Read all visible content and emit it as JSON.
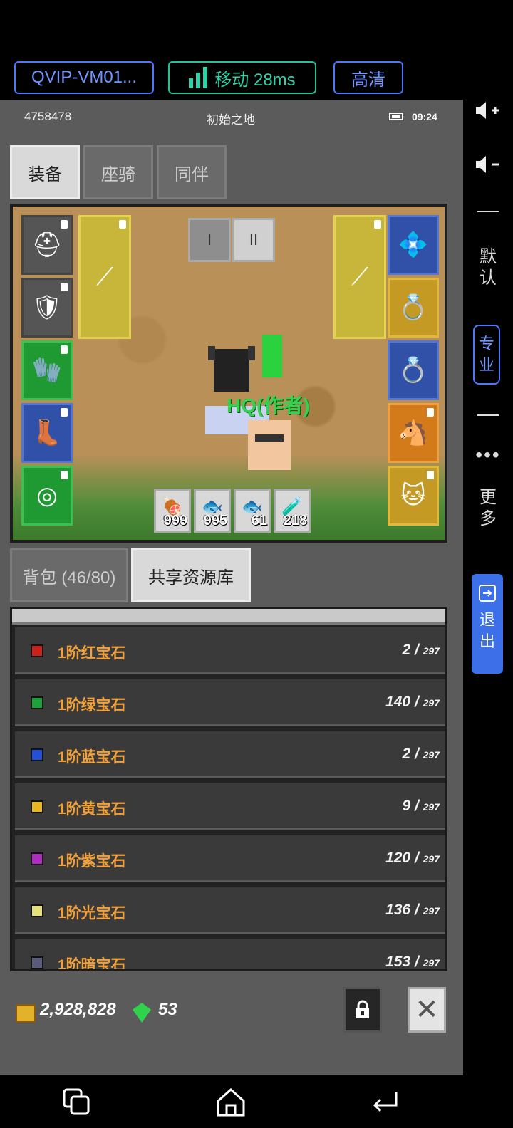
{
  "topbar": {
    "vm_label": "QVIP-VM01...",
    "network_label": "移动 28ms",
    "quality_label": "高清"
  },
  "sidepanel": {
    "default_label": "默认",
    "pro_label": "专业",
    "more_label": "更多",
    "exit_label": "退出"
  },
  "status": {
    "server_id": "4758478",
    "map_name": "初始之地",
    "time": "09:24"
  },
  "equip_tabs": [
    "装备",
    "座骑",
    "同伴"
  ],
  "page_buttons": [
    "I",
    "II"
  ],
  "player_name": "HQ(作者)",
  "quickbar": [
    {
      "icon": "meat-icon",
      "count": "999"
    },
    {
      "icon": "fish-icon",
      "count": "995"
    },
    {
      "icon": "fish-icon",
      "count": "61"
    },
    {
      "icon": "potion-icon",
      "count": "218"
    }
  ],
  "bag_tabs": {
    "bag": "背包 (46/80)",
    "shared": "共享资源库"
  },
  "items": [
    {
      "name": "1阶红宝石",
      "count": "2 /",
      "max": "297",
      "color": "#c8231b"
    },
    {
      "name": "1阶绿宝石",
      "count": "140 /",
      "max": "297",
      "color": "#1da339"
    },
    {
      "name": "1阶蓝宝石",
      "count": "2 /",
      "max": "297",
      "color": "#2450d8"
    },
    {
      "name": "1阶黄宝石",
      "count": "9 /",
      "max": "297",
      "color": "#e6b521"
    },
    {
      "name": "1阶紫宝石",
      "count": "120 /",
      "max": "297",
      "color": "#b02bc0"
    },
    {
      "name": "1阶光宝石",
      "count": "136 /",
      "max": "297",
      "color": "#e6e07a"
    },
    {
      "name": "1阶暗宝石",
      "count": "153 /",
      "max": "297",
      "color": "#5a5a7a"
    }
  ],
  "currency": {
    "gold": "2,928,828",
    "gems": "53"
  },
  "colors": {
    "accent_blue": "#4a78ff",
    "accent_green": "#22c29a",
    "item_name": "#f2a13a"
  }
}
